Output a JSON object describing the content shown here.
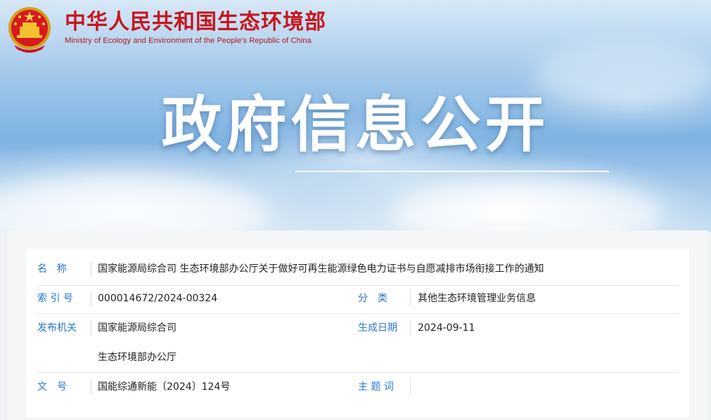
{
  "header": {
    "ministry_cn": "中华人民共和国生态环境部",
    "ministry_en": "Ministry of Ecology and Environment of the People's Republic of China",
    "logo_icon": "national-emblem-icon",
    "banner_title": "政府信息公开"
  },
  "colors": {
    "brand_red": "#c7161e",
    "label_blue": "#2a77c7",
    "sky_blue": "#7fb3e2"
  },
  "info": {
    "name_label": "名　称",
    "name_value": "国家能源局综合司 生态环境部办公厅关于做好可再生能源绿色电力证书与自愿减排市场衔接工作的通知",
    "index_label": "索 引 号",
    "index_value": "000014672/2024-00324",
    "category_label": "分　类",
    "category_value": "其他生态环境管理业务信息",
    "issuer_label": "发布机关",
    "issuer_value_1": "国家能源局综合司",
    "issuer_value_2": "生态环境部办公厅",
    "date_label": "生成日期",
    "date_value": "2024-09-11",
    "docno_label": "文　号",
    "docno_value": "国能综通新能〔2024〕124号",
    "subject_label": "主 题 词",
    "subject_value": ""
  }
}
